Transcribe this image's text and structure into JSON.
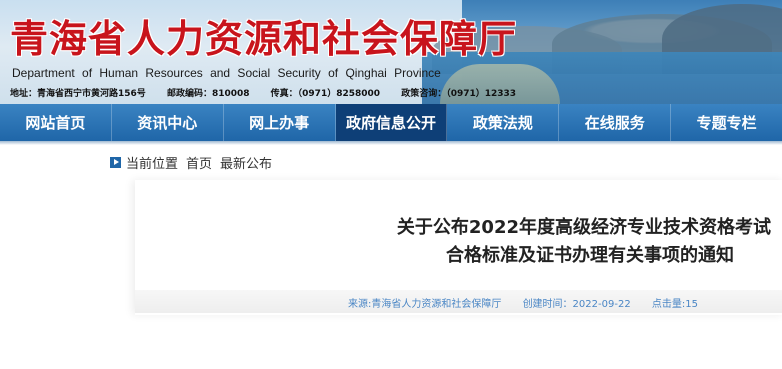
{
  "header": {
    "title": "青海省人力资源和社会保障厅",
    "english": "Department of Human Resources and Social Security of Qinghai Province",
    "address": "地址：青海省西宁市黄河路156号",
    "postcode": "邮政编码：810008",
    "fax": "传真：（0971）8258000",
    "hotline": "政策咨询：（0971）12333"
  },
  "nav": {
    "items": [
      {
        "label": "网站首页"
      },
      {
        "label": "资讯中心"
      },
      {
        "label": "网上办事"
      },
      {
        "label": "政府信息公开",
        "active": true
      },
      {
        "label": "政策法规"
      },
      {
        "label": "在线服务"
      },
      {
        "label": "专题专栏"
      }
    ]
  },
  "breadcrumb": {
    "label": "当前位置",
    "home": "首页",
    "current": "最新公布"
  },
  "article": {
    "title_line1": "关于公布2022年度高级经济专业技术资格考试",
    "title_line2": "合格标准及证书办理有关事项的通知",
    "source": "来源:青海省人力资源和社会保障厅",
    "created": "创建时间：2022-09-22",
    "clicks": "点击量:15"
  },
  "colors": {
    "title_red": "#c8141c",
    "nav_blue": "#1f66a8",
    "nav_active": "#0e3f77",
    "meta_blue": "#4a86c5"
  }
}
